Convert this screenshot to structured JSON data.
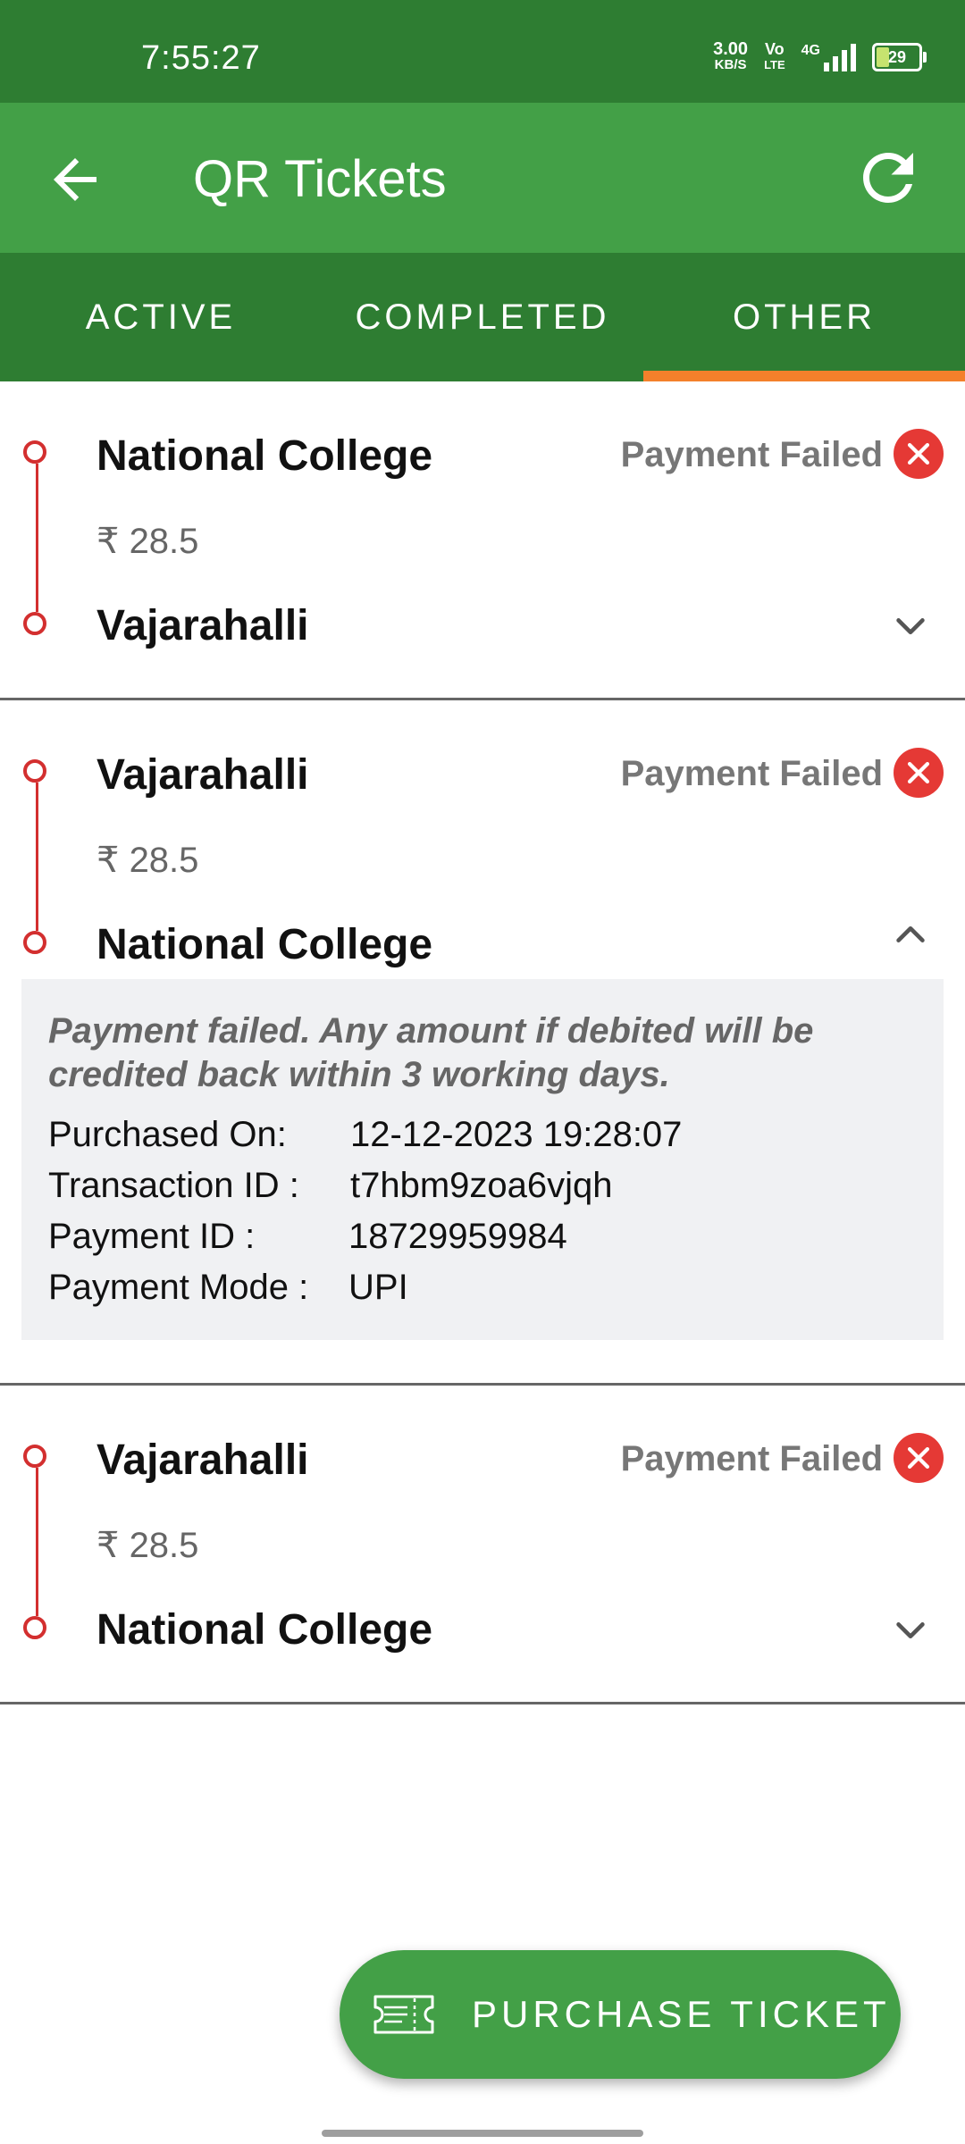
{
  "status_bar": {
    "time": "7:55:27",
    "net_speed_value": "3.00",
    "net_speed_unit": "KB/S",
    "volte_top": "Vo",
    "volte_bottom": "LTE",
    "network_type": "4G",
    "battery_level": "29"
  },
  "app_bar": {
    "title": "QR Tickets",
    "back_icon": "arrow-left-icon",
    "refresh_icon": "refresh-icon"
  },
  "tabs": [
    {
      "label": "ACTIVE",
      "selected": false
    },
    {
      "label": "COMPLETED",
      "selected": false
    },
    {
      "label": "OTHER",
      "selected": true
    }
  ],
  "tickets": [
    {
      "from": "National College",
      "to": "Vajarahalli",
      "fare": "₹ 28.5",
      "status": "Payment Failed",
      "expanded": false
    },
    {
      "from": "Vajarahalli",
      "to": "National College",
      "fare": "₹ 28.5",
      "status": "Payment Failed",
      "expanded": true,
      "details": {
        "message": "Payment failed. Any amount if debited will be credited back within 3 working days.",
        "purchased_on_label": "Purchased On:",
        "purchased_on": "12-12-2023 19:28:07",
        "transaction_id_label": "Transaction ID :",
        "transaction_id": "t7hbm9zoa6vjqh",
        "payment_id_label": "Payment ID :",
        "payment_id": "18729959984",
        "payment_mode_label": "Payment Mode :",
        "payment_mode": "UPI"
      }
    },
    {
      "from": "Vajarahalli",
      "to": "National College",
      "fare": "₹ 28.5",
      "status": "Payment Failed",
      "expanded": false
    }
  ],
  "purchase_button": {
    "label": "PURCHASE TICKET",
    "icon": "ticket-icon"
  },
  "colors": {
    "status_bar": "#2e7d32",
    "app_bar": "#43a047",
    "tab_indicator": "#f4802b",
    "route_red": "#d32f2f",
    "fail_red": "#e53935"
  }
}
